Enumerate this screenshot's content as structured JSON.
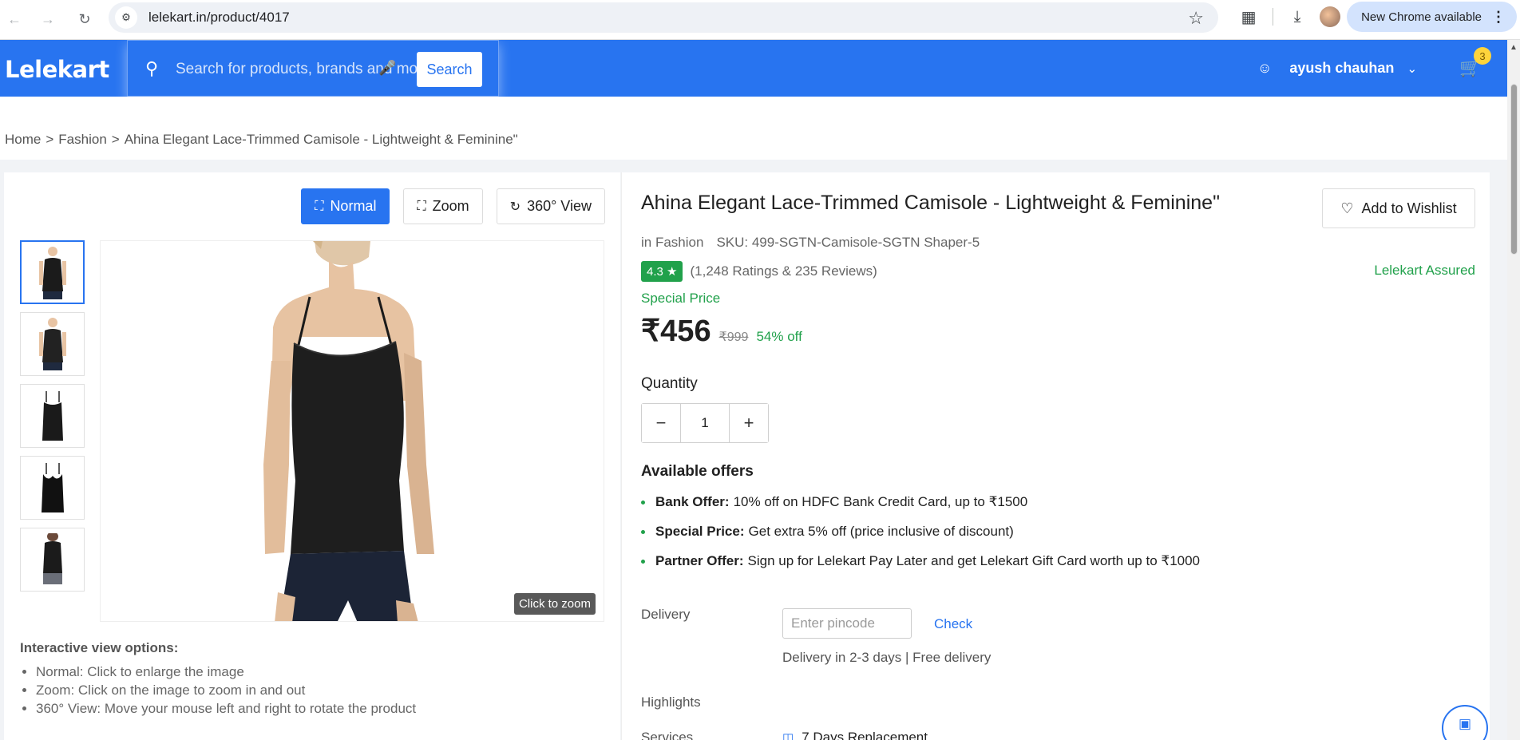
{
  "browser": {
    "url": "lelekart.in/product/4017",
    "update_label": "New Chrome available"
  },
  "header": {
    "logo": "Lelekart",
    "search_placeholder": "Search for products, brands and more",
    "search_button": "Search",
    "user_name": "ayush chauhan",
    "cart_count": "3",
    "brand_color": "#2874f0"
  },
  "breadcrumb": [
    "Home",
    ">",
    "Fashion",
    ">",
    "Ahina Elegant Lace-Trimmed Camisole - Lightweight & Feminine\""
  ],
  "gallery": {
    "view_buttons": [
      "Normal",
      "Zoom",
      "360° View"
    ],
    "active_view": "Normal",
    "zoom_hint": "Click to zoom",
    "options_title": "Interactive view options:",
    "options": [
      "Normal: Click to enlarge the image",
      "Zoom: Click on the image to zoom in and out",
      "360° View: Move your mouse left and right to rotate the product"
    ]
  },
  "product": {
    "title": "Ahina Elegant Lace-Trimmed Camisole - Lightweight & Feminine\"",
    "wishlist": "Add to Wishlist",
    "category": "in Fashion",
    "sku": "SKU: 499-SGTN-Camisole-SGTN Shaper-5",
    "rating": "4.3",
    "rating_text": "(1,248 Ratings & 235 Reviews)",
    "assured": "Lelekart Assured",
    "special_label": "Special Price",
    "price": "₹456",
    "mrp": "₹999",
    "discount": "54% off",
    "quantity_label": "Quantity",
    "quantity": "1",
    "offers_title": "Available offers",
    "offers": [
      {
        "label": "Bank Offer:",
        "text": "10% off on HDFC Bank Credit Card, up to ₹1500"
      },
      {
        "label": "Special Price:",
        "text": "Get extra 5% off (price inclusive of discount)"
      },
      {
        "label": "Partner Offer:",
        "text": "Sign up for Lelekart Pay Later and get Lelekart Gift Card worth up to ₹1000"
      }
    ],
    "delivery_label": "Delivery",
    "pincode_placeholder": "Enter pincode",
    "check_label": "Check",
    "delivery_info": "Delivery in 2-3 days | Free delivery",
    "highlights_label": "Highlights",
    "services_label": "Services",
    "replacement": "7 Days Replacement"
  }
}
